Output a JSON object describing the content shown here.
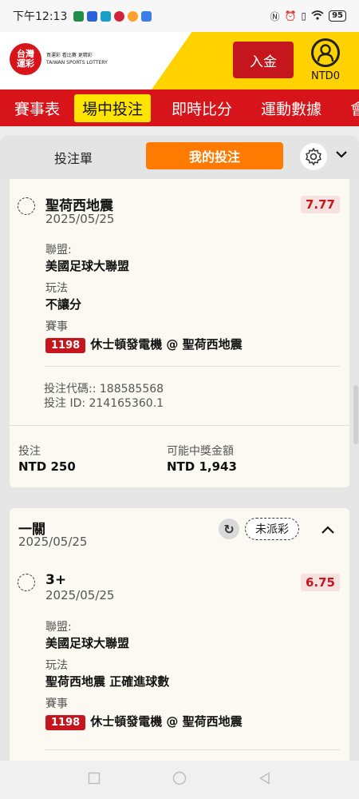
{
  "status_bar": {
    "time": "下午12:13",
    "battery": "95"
  },
  "header": {
    "logo_text": "台灣\n運彩",
    "logo_tagline": "買運彩 看比賽 更精彩",
    "logo_en": "TAIWAN SPORTS LOTTERY",
    "deposit_label": "入金",
    "balance": "NTD0"
  },
  "main_nav": {
    "items": [
      "賽事表",
      "場中投注",
      "即時比分",
      "運動數據",
      "會"
    ]
  },
  "slip_tabs": {
    "betslip_label": "投注單",
    "mybets_label": "我的投注"
  },
  "bet1": {
    "selection": "聖荷西地震",
    "date": "2025/05/25",
    "odds": "7.77",
    "league_label": "聯盟:",
    "league": "美國足球大聯盟",
    "market_label": "玩法",
    "market": "不讓分",
    "event_label": "賽事",
    "event_id": "1198",
    "event_name": "休士頓發電機 @ 聖荷西地震",
    "code_line": "投注代碼:: 188585568",
    "id_line": "投注 ID: 214165360.1",
    "stake_label": "投注",
    "stake": "NTD 250",
    "payout_label": "可能中獎金額",
    "payout": "NTD 1,943"
  },
  "bet2": {
    "type": "一關",
    "date": "2025/05/25",
    "status": "未派彩",
    "selection": "3+",
    "sel_date": "2025/05/25",
    "odds": "6.75",
    "league_label": "聯盟:",
    "league": "美國足球大聯盟",
    "market_label": "玩法",
    "market": "聖荷西地震 正確進球數",
    "event_label": "賽事",
    "event_id": "1198",
    "event_name": "休士頓發電機 @ 聖荷西地震"
  }
}
